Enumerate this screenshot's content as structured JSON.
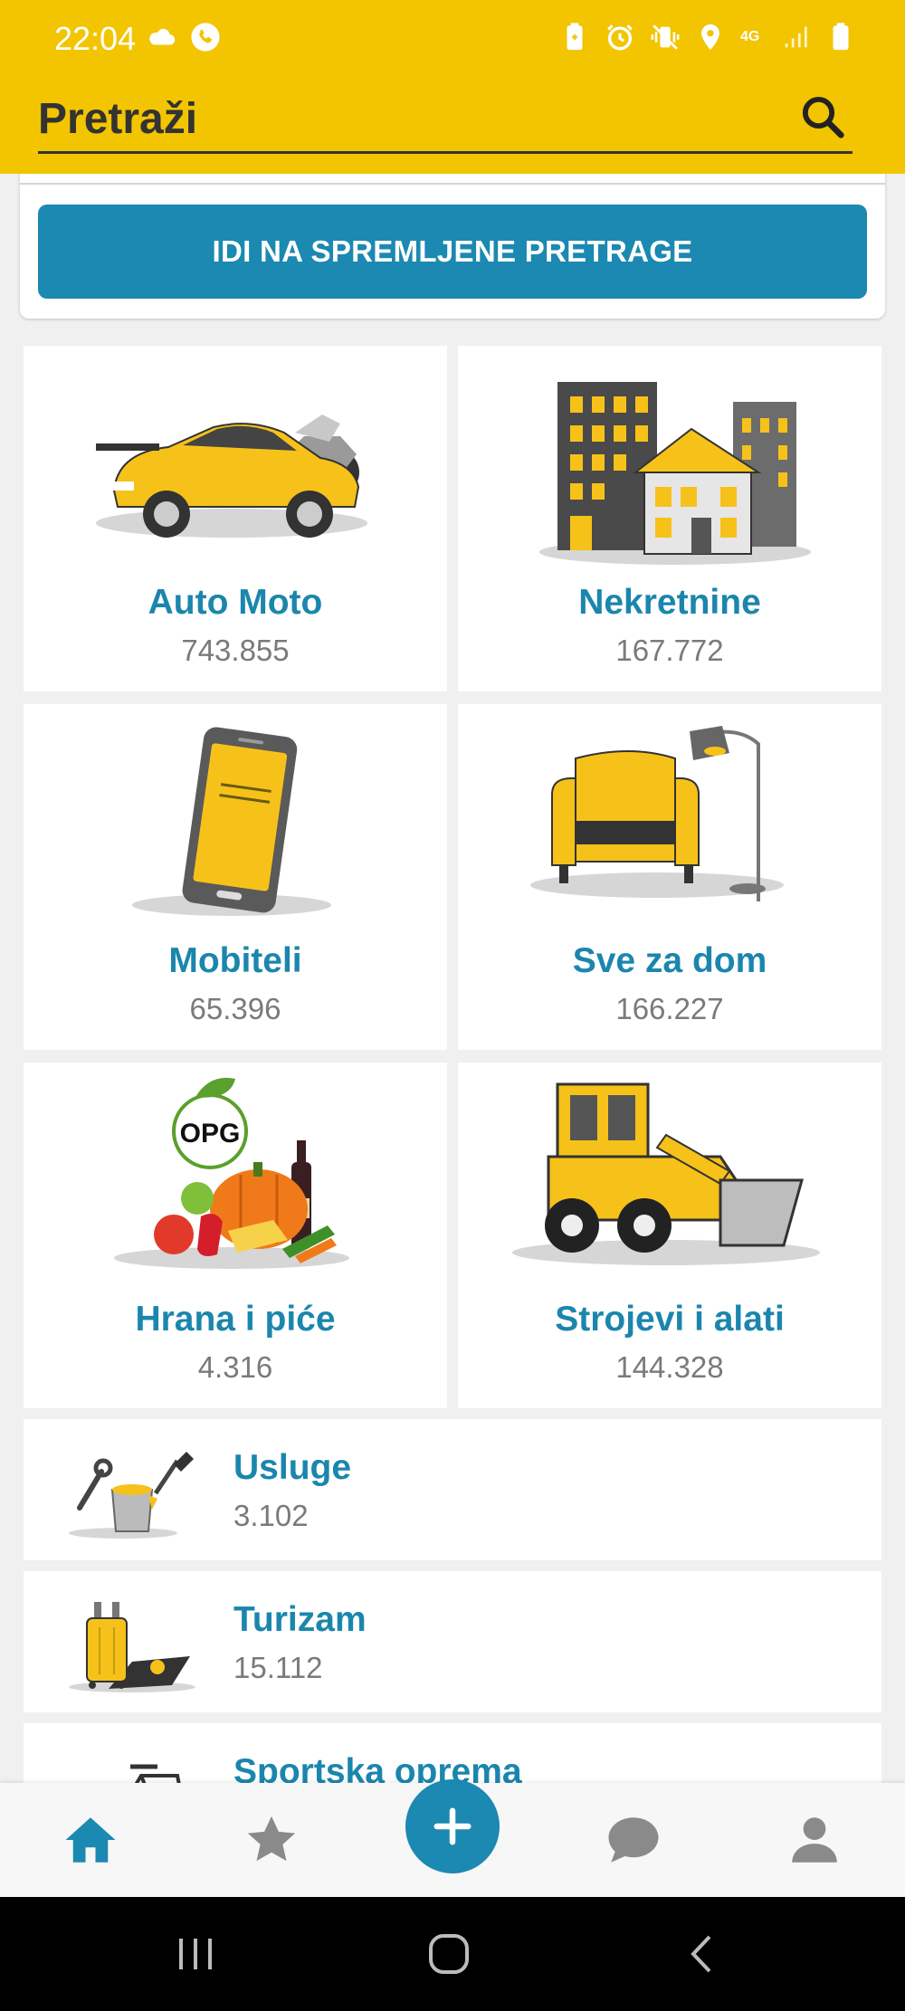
{
  "status_bar": {
    "time": "22:04",
    "left_icons": [
      "cloud-icon",
      "call-icon"
    ],
    "right_icons": [
      "battery-saver-icon",
      "alarm-icon",
      "vibrate-icon",
      "location-icon",
      "network-4g-icon",
      "signal-icon",
      "battery-icon"
    ],
    "network_label": "4G"
  },
  "search": {
    "placeholder": "Pretraži",
    "icon": "search-icon"
  },
  "saved_searches": {
    "button_label": "IDI NA SPREMLJENE PRETRAGE"
  },
  "categories": [
    {
      "name": "Auto Moto",
      "count": "743.855",
      "icon": "car-motorcycle-icon"
    },
    {
      "name": "Nekretnine",
      "count": "167.772",
      "icon": "buildings-icon"
    },
    {
      "name": "Mobiteli",
      "count": "65.396",
      "icon": "smartphone-icon"
    },
    {
      "name": "Sve za dom",
      "count": "166.227",
      "icon": "armchair-lamp-icon"
    },
    {
      "name": "Hrana i piće",
      "count": "4.316",
      "icon": "food-drink-icon",
      "badge": "OPG"
    },
    {
      "name": "Strojevi i alati",
      "count": "144.328",
      "icon": "bulldozer-icon"
    }
  ],
  "category_rows": [
    {
      "name": "Usluge",
      "count": "3.102",
      "icon": "tools-paint-icon"
    },
    {
      "name": "Turizam",
      "count": "15.112",
      "icon": "suitcase-icon"
    },
    {
      "name": "Sportska oprema",
      "count": "",
      "icon": "bicycle-icon"
    }
  ],
  "bottom_nav": {
    "items": [
      "home-icon",
      "favorites-star-icon",
      "add-ad-icon",
      "messages-icon",
      "profile-icon"
    ],
    "active": "home-icon"
  },
  "colors": {
    "header_yellow": "#f2c500",
    "accent_blue": "#1b89b1",
    "title_blue": "#1b86ad",
    "count_gray": "#7a7a7a"
  }
}
